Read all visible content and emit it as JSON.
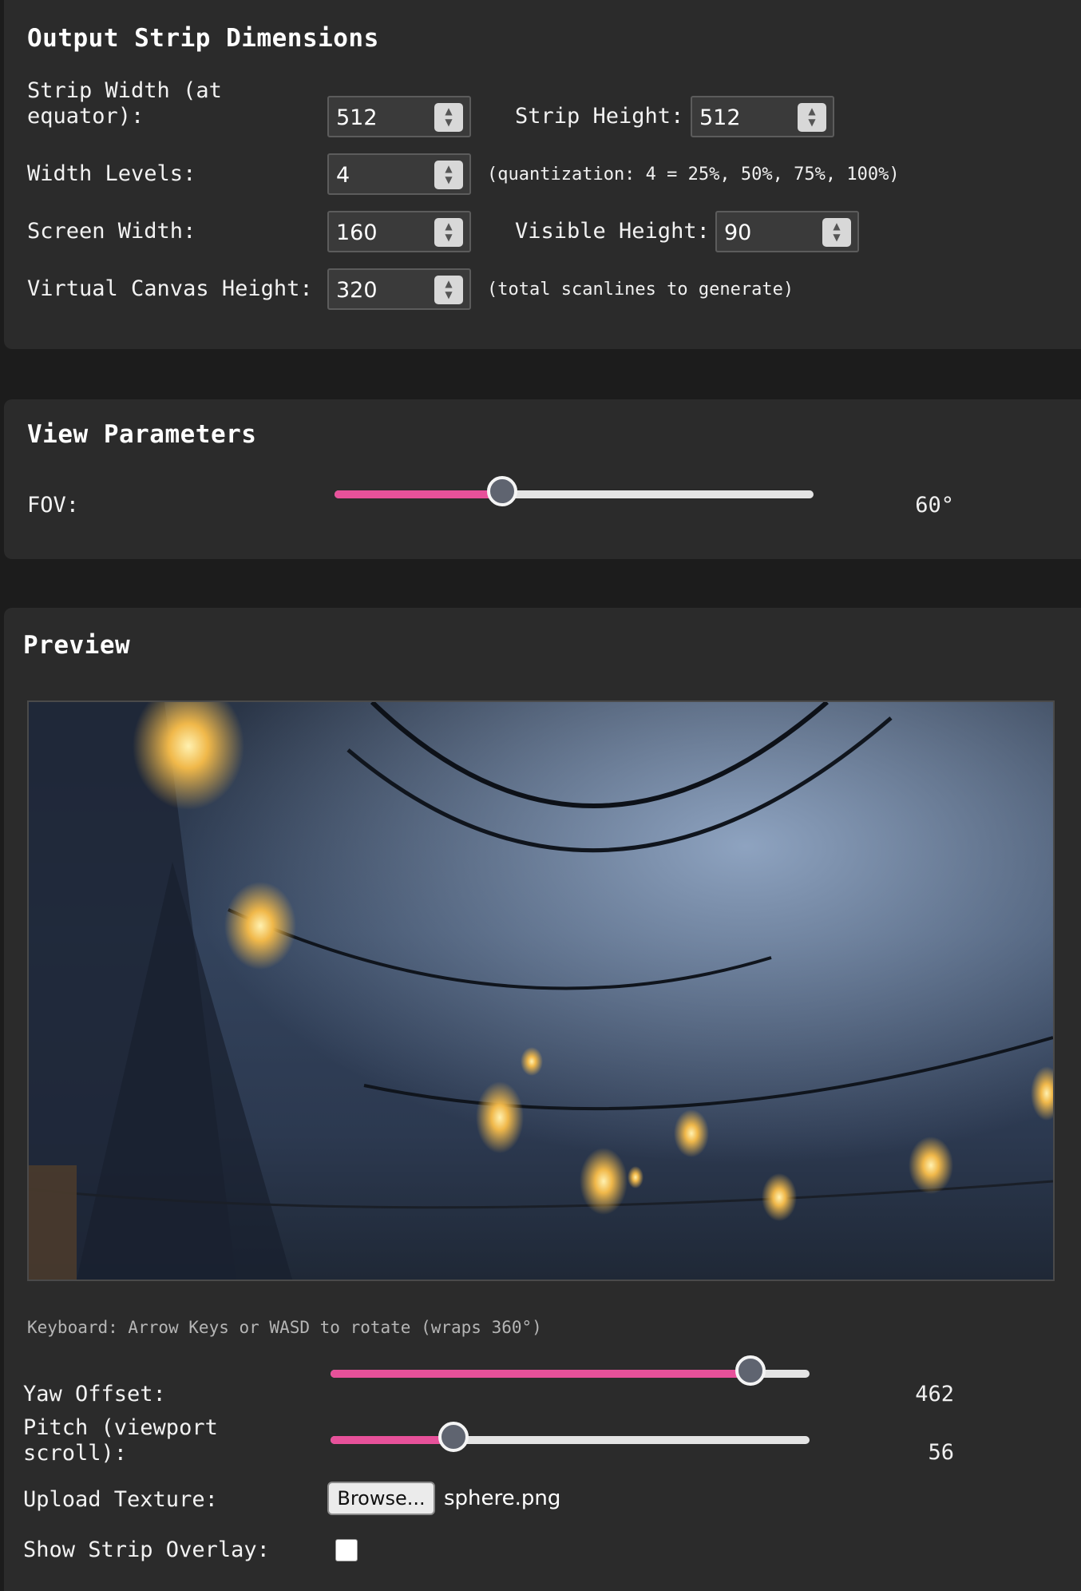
{
  "output": {
    "title": "Output Strip Dimensions",
    "strip_width_label": "Strip Width (at\nequator):",
    "strip_width": "512",
    "strip_height_label": "Strip Height:",
    "strip_height": "512",
    "width_levels_label": "Width Levels:",
    "width_levels": "4",
    "width_levels_note": "(quantization: 4 = 25%, 50%, 75%, 100%)",
    "screen_width_label": "Screen Width:",
    "screen_width": "160",
    "visible_height_label": "Visible Height:",
    "visible_height": "90",
    "canvas_height_label": "Virtual Canvas Height:",
    "canvas_height": "320",
    "canvas_height_note": "(total scanlines to generate)"
  },
  "view": {
    "title": "View Parameters",
    "fov_label": "FOV:",
    "fov_value": "60°",
    "fov_fraction": 0.35
  },
  "preview": {
    "title": "Preview",
    "hint": "Keyboard: Arrow Keys or WASD to rotate (wraps 360°)",
    "yaw_label": "Yaw Offset:",
    "yaw_value": "462",
    "yaw_fraction": 0.877,
    "pitch_label": "Pitch (viewport\nscroll):",
    "pitch_value": "56",
    "pitch_fraction": 0.257,
    "upload_label": "Upload Texture:",
    "browse_label": "Browse...",
    "file_name": "sphere.png",
    "overlay_label": "Show Strip Overlay:",
    "overlay_checked": false
  },
  "colors": {
    "accent": "#e7519a",
    "panel": "#2b2b2b",
    "background": "#1c1c1c"
  },
  "icons": {
    "spinner": "up-down-chevron-icon"
  }
}
